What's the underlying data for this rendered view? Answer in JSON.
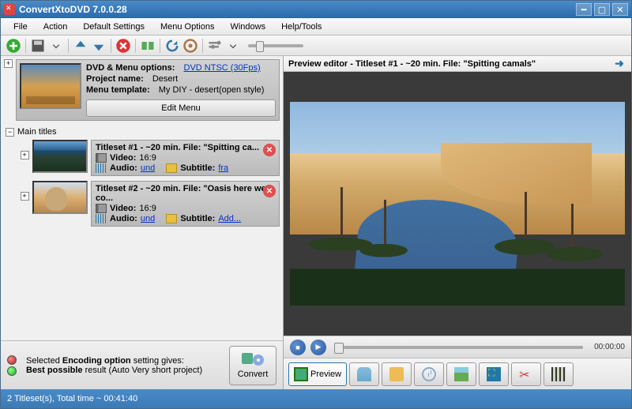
{
  "titlebar": {
    "title": "ConvertXtoDVD 7.0.0.28"
  },
  "menubar": [
    "File",
    "Action",
    "Default Settings",
    "Menu Options",
    "Windows",
    "Help/Tools"
  ],
  "dvdblock": {
    "options_label": "DVD & Menu options:",
    "options_link": "DVD NTSC (30Fps)",
    "project_label": "Project name:",
    "project_value": "Desert",
    "template_label": "Menu template:",
    "template_value": "My  DIY - desert(open style)",
    "edit_menu": "Edit Menu"
  },
  "main_titles_label": "Main titles",
  "titlesets": [
    {
      "title": "Titleset #1 - ~20 min. File: \"Spitting ca...",
      "video_label": "Video:",
      "video_value": "16:9",
      "audio_label": "Audio:",
      "audio_link": "und",
      "subtitle_label": "Subtitle:",
      "subtitle_link": "fra"
    },
    {
      "title": "Titleset #2 - ~20 min. File: \"Oasis here we co...",
      "video_label": "Video:",
      "video_value": "16:9",
      "audio_label": "Audio:",
      "audio_link": "und",
      "subtitle_label": "Subtitle:",
      "subtitle_link": "Add..."
    }
  ],
  "encoding": {
    "line1a": "Selected ",
    "line1b": "Encoding option",
    "line1c": " setting gives:",
    "line2a": "Best possible",
    "line2b": " result (Auto Very short project)"
  },
  "convert_label": "Convert",
  "preview": {
    "header": "Preview editor - Titleset #1 - ~20 min. File: \"Spitting camals\"",
    "time": "00:00:00"
  },
  "tabs": {
    "preview": "Preview"
  },
  "statusbar": "2 Titleset(s), Total time ~ 00:41:40"
}
